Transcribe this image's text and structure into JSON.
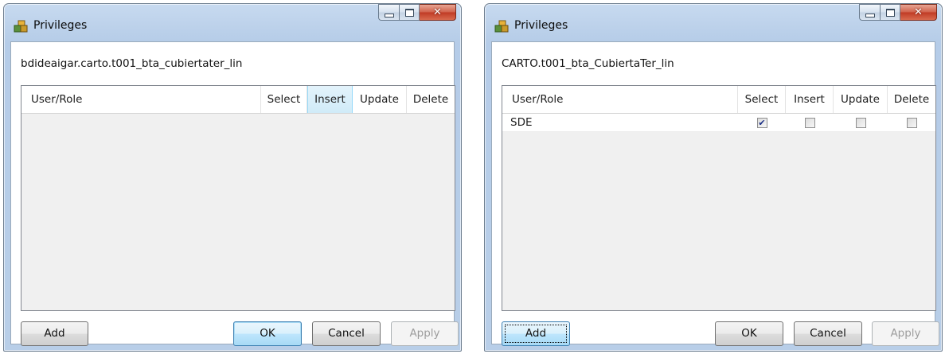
{
  "colors": {
    "window_frame": "#b9cfe9",
    "close_button": "#c8452c",
    "check": "#1b2f86",
    "header_hover": "#d6eef9"
  },
  "icons": {
    "app": "privileges-cubes-icon",
    "minimize": "minimize-icon",
    "maximize": "maximize-icon",
    "close": "close-icon"
  },
  "win1": {
    "title": "Privileges",
    "object_name": "bdideaigar.carto.t001_bta_cubiertater_lin",
    "columns": [
      "User/Role",
      "Select",
      "Insert",
      "Update",
      "Delete"
    ],
    "hovered_column": "Insert",
    "rows": [],
    "buttons": {
      "add": "Add",
      "ok": "OK",
      "cancel": "Cancel",
      "apply": "Apply"
    },
    "apply_enabled": false,
    "close_glyph": "✕"
  },
  "win2": {
    "title": "Privileges",
    "object_name": "CARTO.t001_bta_CubiertaTer_lin",
    "columns": [
      "User/Role",
      "Select",
      "Insert",
      "Update",
      "Delete"
    ],
    "rows": [
      {
        "user": "SDE",
        "select": true,
        "insert": false,
        "update": false,
        "delete": false
      }
    ],
    "buttons": {
      "add": "Add",
      "ok": "OK",
      "cancel": "Cancel",
      "apply": "Apply"
    },
    "apply_enabled": false,
    "focused_button": "Add",
    "close_glyph": "✕"
  }
}
